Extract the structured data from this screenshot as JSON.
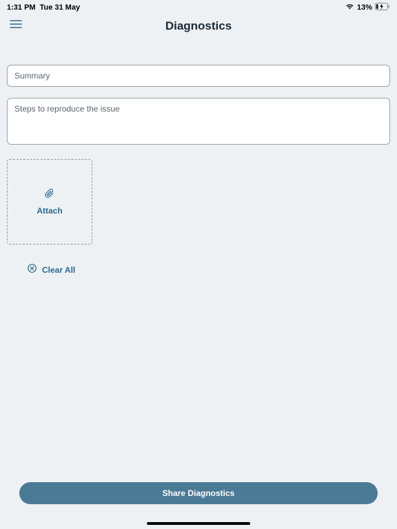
{
  "statusBar": {
    "time": "1:31 PM",
    "date": "Tue 31 May",
    "battery": "13%"
  },
  "header": {
    "title": "Diagnostics"
  },
  "form": {
    "summaryPlaceholder": "Summary",
    "stepsPlaceholder": "Steps to reproduce the issue"
  },
  "attach": {
    "label": "Attach"
  },
  "clear": {
    "label": "Clear All"
  },
  "share": {
    "label": "Share Diagnostics"
  }
}
